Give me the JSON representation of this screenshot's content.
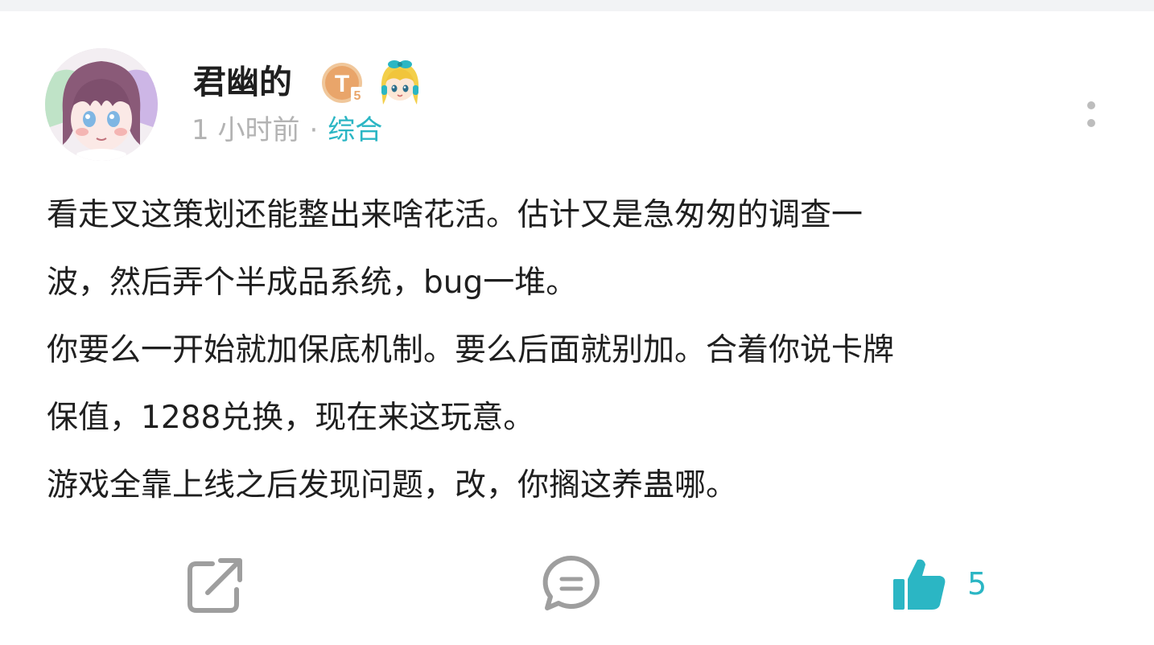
{
  "post": {
    "username": "君幽的",
    "level_badge_text": "T",
    "level_badge_sub": "5",
    "time": "1 小时前",
    "separator": "·",
    "section": "综合",
    "paragraphs": [
      "看走叉这策划还能整出来啥花活。估计又是急匆匆的调查一",
      "波，然后弄个半成品系统，bug一堆。",
      "你要么一开始就加保底机制。要么后面就别加。合着你说卡牌",
      "保值，1288兑换，现在来这玩意。",
      "游戏全靠上线之后发现问题，改，你搁这养蛊哪。"
    ]
  },
  "actions": {
    "share_icon": "share-icon",
    "comment_icon": "comment-icon",
    "like_icon": "thumbs-up-icon",
    "like_count": "5"
  },
  "colors": {
    "accent": "#2bb6c4",
    "text": "#1f1f1f",
    "muted": "#b3b3b3",
    "icon_gray": "#9e9e9e",
    "badge_orange": "#e9a56a"
  }
}
